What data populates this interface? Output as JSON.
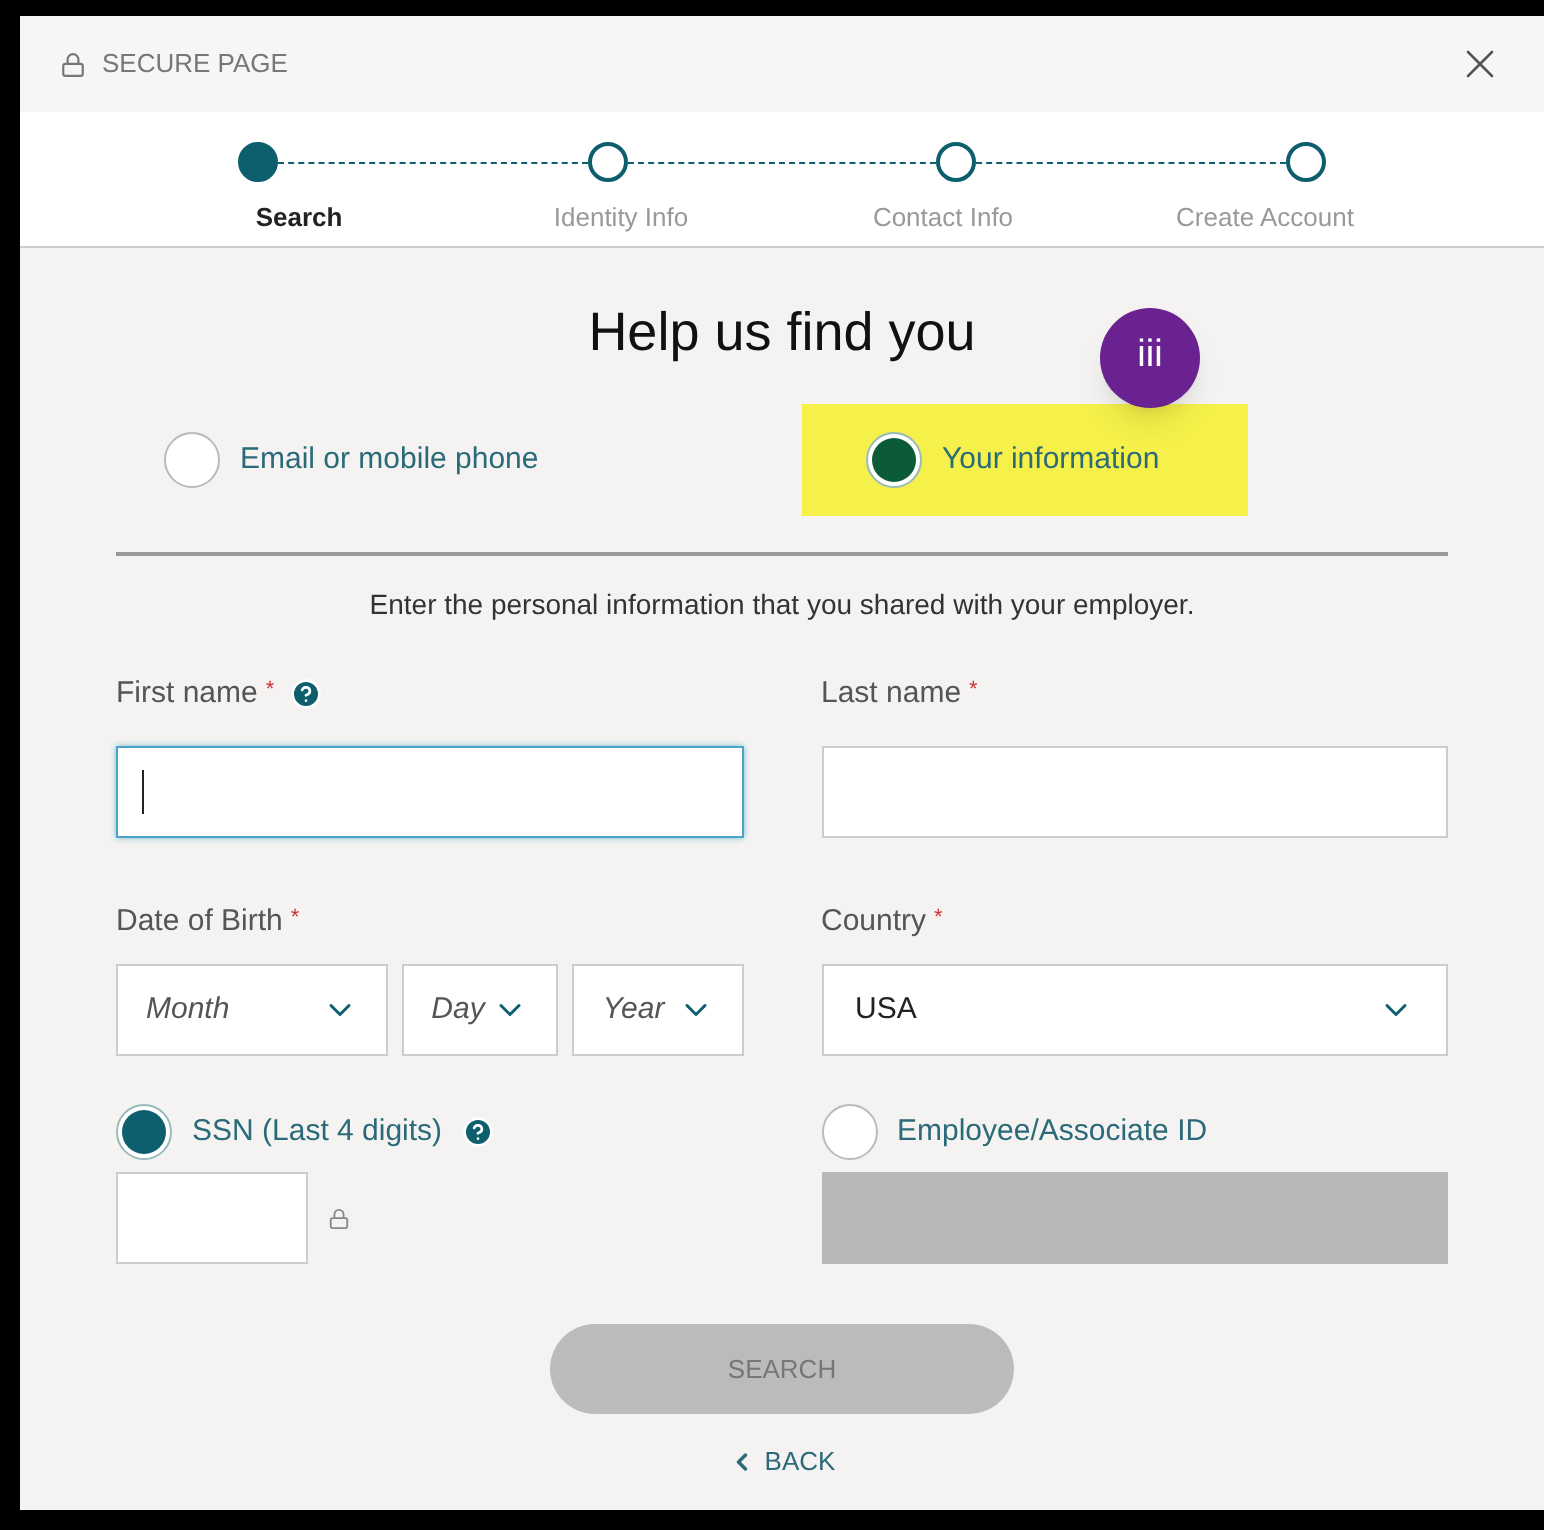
{
  "header": {
    "title": "SECURE PAGE"
  },
  "steps": [
    {
      "label": "Search",
      "selected": true
    },
    {
      "label": "Identity Info",
      "selected": false
    },
    {
      "label": "Contact Info",
      "selected": false
    },
    {
      "label": "Create Account",
      "selected": false
    }
  ],
  "title": "Help us find you",
  "badge": "iii",
  "lookup_options": [
    {
      "label": "Email or mobile phone",
      "selected": false,
      "highlighted": false
    },
    {
      "label": "Your information",
      "selected": true,
      "highlighted": true
    }
  ],
  "instruction": "Enter the personal information that you shared with your employer.",
  "name_fields": [
    {
      "label": "First name",
      "required_mark": "*",
      "help": true,
      "focused": true
    },
    {
      "label": "Last name",
      "required_mark": "*",
      "help": false,
      "focused": false
    }
  ],
  "dob": {
    "label": "Date of Birth",
    "required_mark": "*",
    "selects": [
      {
        "placeholder": "Month"
      },
      {
        "placeholder": "Day"
      },
      {
        "placeholder": "Year"
      }
    ]
  },
  "country": {
    "label": "Country",
    "required_mark": "*",
    "value": "USA"
  },
  "id_options": [
    {
      "label": "SSN (Last 4 digits)",
      "selected": true,
      "help": true
    },
    {
      "label": "Employee/Associate ID",
      "selected": false,
      "help": false
    }
  ],
  "search_button": {
    "label": "SEARCH",
    "disabled": true
  },
  "back_link": {
    "label": "BACK"
  }
}
